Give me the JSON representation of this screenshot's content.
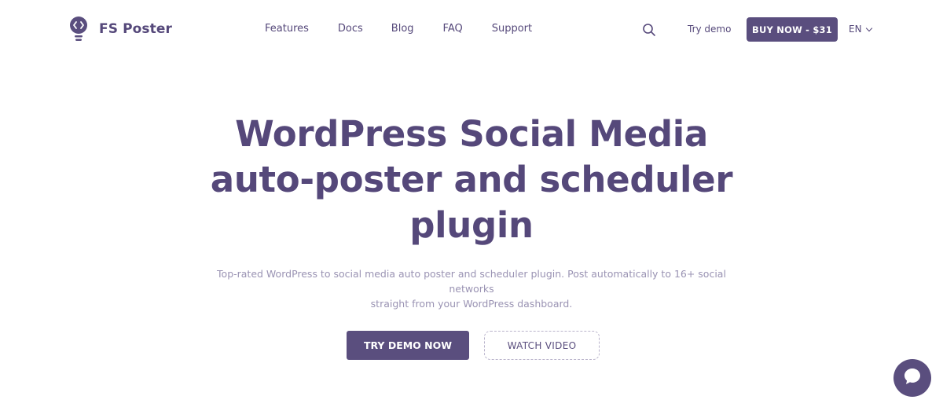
{
  "brand": {
    "name": "FS Poster"
  },
  "nav": {
    "items": [
      {
        "label": "Features"
      },
      {
        "label": "Docs"
      },
      {
        "label": "Blog"
      },
      {
        "label": "FAQ"
      },
      {
        "label": "Support"
      }
    ]
  },
  "header": {
    "try_demo_label": "Try demo",
    "buy_label": "BUY NOW - $31",
    "language": "EN"
  },
  "hero": {
    "title_line1": "WordPress Social Media",
    "title_line2": "auto-poster and scheduler",
    "title_line3": "plugin",
    "subtitle_line1": "Top-rated WordPress to social media auto poster and scheduler plugin. Post automatically to 16+ social networks",
    "subtitle_line2": "straight from your WordPress dashboard.",
    "primary_cta": "TRY DEMO NOW",
    "secondary_cta": "WATCH VIDEO"
  },
  "colors": {
    "brand": "#5a4e7e",
    "subtitle": "#9a93b3",
    "background": "#ffffff"
  },
  "icons": {
    "logo": "lightbulb-code-icon",
    "search": "search-icon",
    "language_dropdown": "chevron-down-icon",
    "chat": "chat-bubble-icon"
  }
}
